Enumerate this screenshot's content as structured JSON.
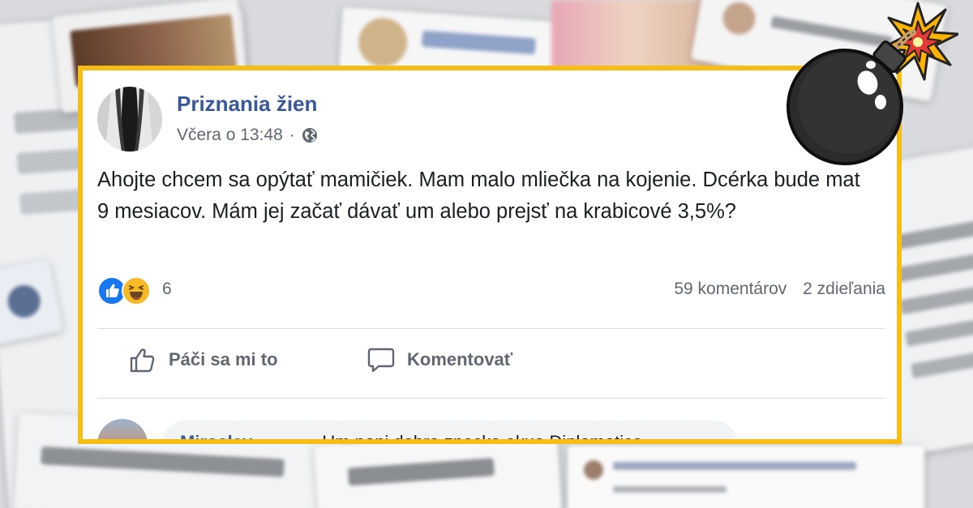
{
  "post": {
    "page_name": "Priznania žien",
    "timestamp": "Včera o 13:48",
    "separator": "·",
    "text": "Ahojte chcem sa opýtať mamičiek. Mam malo mliečka na kojenie. Dcérka bude mat 9 mesiacov. Mám jej začať dávať um alebo prejsť na krabicové 3,5%?",
    "reaction_count": "6",
    "comments_count": "59 komentárov",
    "shares_count": "2 zdieľania",
    "actions": {
      "like_label": "Páči sa mi to",
      "comment_label": "Komentovať"
    },
    "top_comment": {
      "author": "Miroslav",
      "text": "Um poni dobra znacka akua Diplomatica"
    }
  },
  "icons": {
    "audience": "globe-icon",
    "like": "thumbs-up-icon",
    "comment": "speech-bubble-icon",
    "reactions": [
      "like-reaction-icon",
      "haha-reaction-icon"
    ],
    "decoration": "bomb-icon"
  },
  "colors": {
    "frame": "#f6bd16",
    "page_name": "#385898",
    "meta_text": "#606770",
    "like_blue": "#1877f2",
    "haha_yellow": "#f7b928"
  }
}
